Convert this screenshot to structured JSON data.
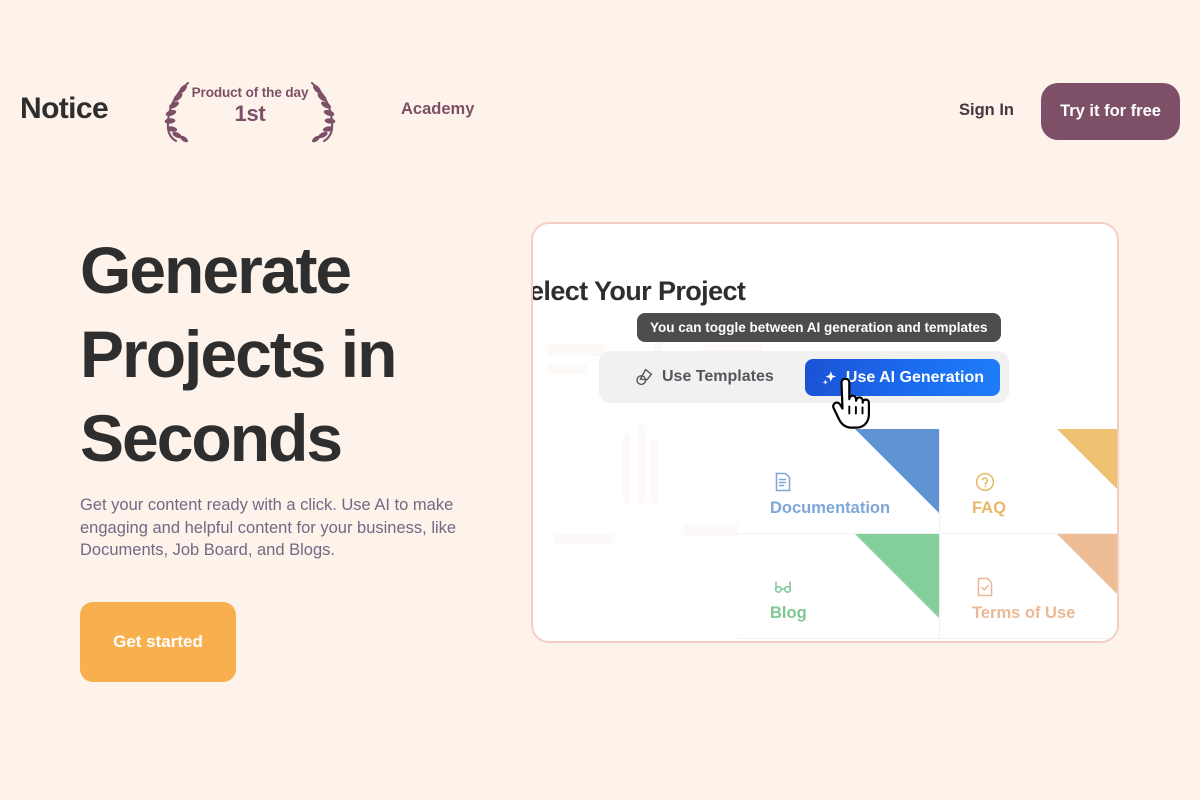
{
  "brand": {
    "logo": "Notice"
  },
  "award_badge": {
    "title": "Product of the day",
    "rank": "1st",
    "left_icon": "laurel-wreath-left-icon",
    "right_icon": "laurel-wreath-right-icon"
  },
  "nav": {
    "academy": "Academy",
    "sign_in": "Sign In",
    "cta": "Try it for free"
  },
  "hero": {
    "title": "Generate Projects in Seconds",
    "subtitle": "Get your content ready with a click. Use AI to make engaging and helpful content for your business, like Documents, Job Board, and Blogs.",
    "button": "Get started"
  },
  "product_panel": {
    "heading": "elect Your Project",
    "tooltip": "You can toggle between AI generation and templates",
    "toggle": {
      "templates_label": "Use Templates",
      "templates_icon": "shapes-icon",
      "ai_label": "Use AI Generation",
      "ai_icon": "sparkle-icon"
    },
    "cursor_icon": "hand-pointer-cursor",
    "cards": [
      {
        "label": "Documentation",
        "icon": "document-icon",
        "color": "#7ea6d8",
        "ribbon": "#5f93d4"
      },
      {
        "label": "FAQ",
        "icon": "question-circle-icon",
        "color": "#e9b866",
        "ribbon": "#efc173"
      },
      {
        "label": "Blog",
        "icon": "glasses-icon",
        "color": "#7dc894",
        "ribbon": "#84cf9b"
      },
      {
        "label": "Terms of Use",
        "icon": "document-check-icon",
        "color": "#eab894",
        "ribbon": "#efbd95"
      }
    ]
  },
  "colors": {
    "page_background": "#fdf3ea",
    "plum": "#7d5068",
    "orange": "#f8b04e",
    "headline": "#2e2e2e",
    "subtitle": "#6f6a85",
    "panel_border": "#f3cfc2",
    "tooltip_background": "#4d4d4d",
    "ai_button_blue": "#1b6cf0"
  }
}
